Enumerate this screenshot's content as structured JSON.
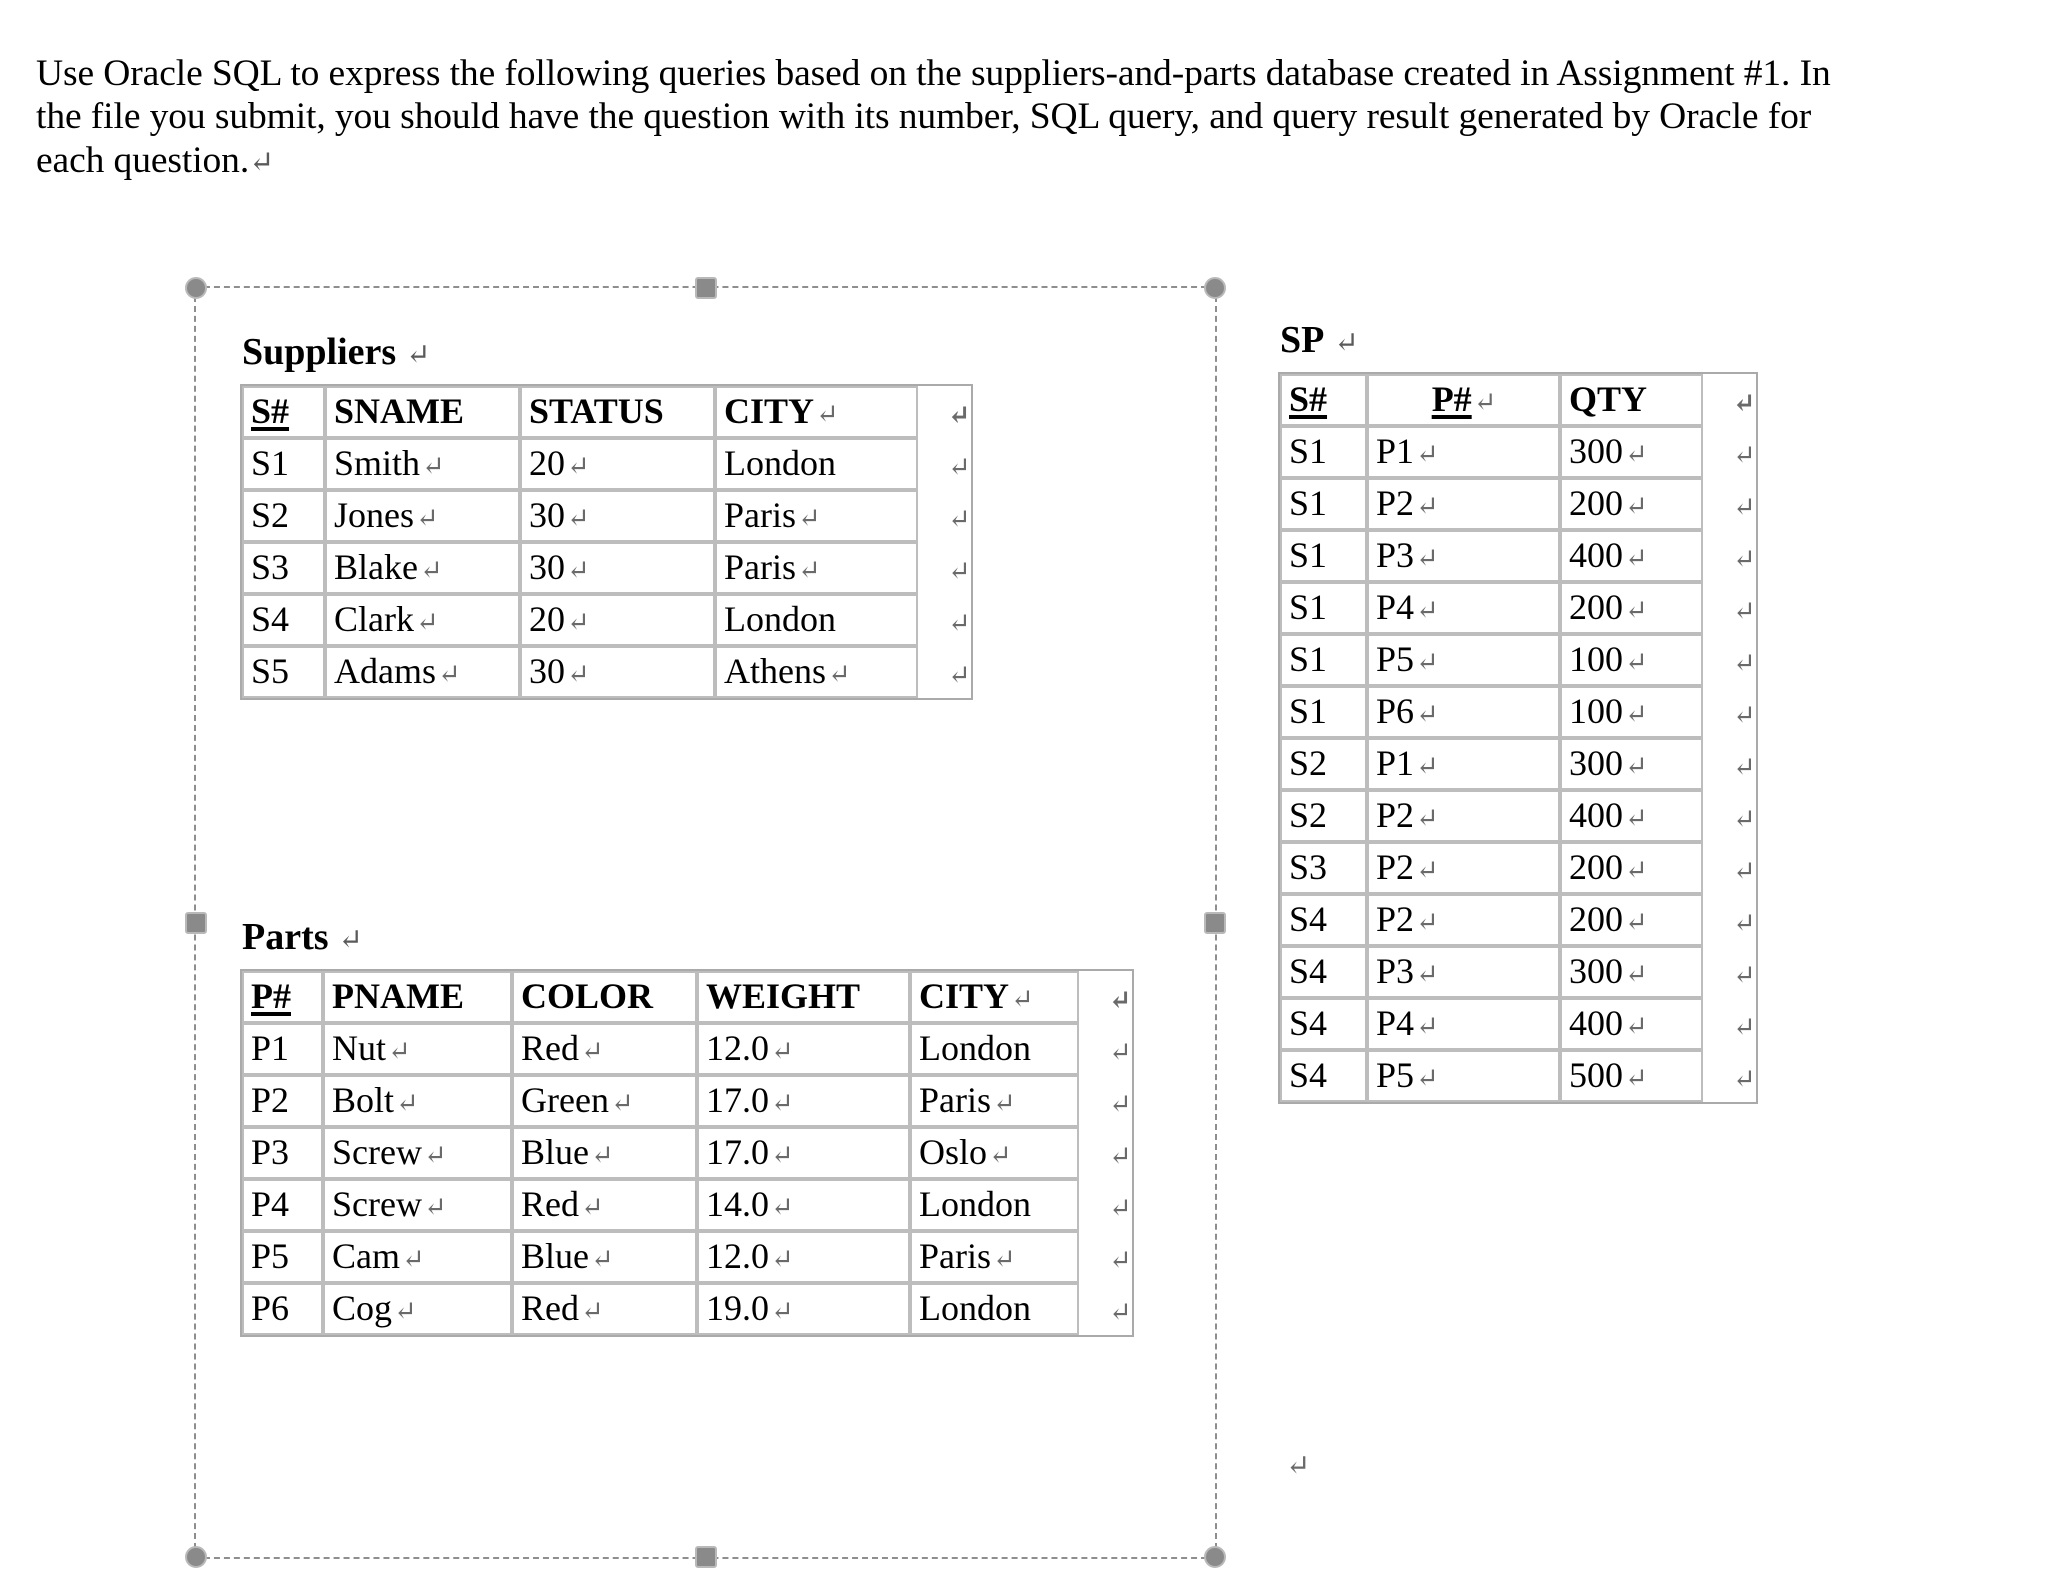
{
  "document": {
    "intro_text": "Use Oracle SQL to express the following queries based on the suppliers-and-parts database created in Assignment #1. In the file you submit, you should have the question with its number, SQL query, and query result generated by Oracle for each question.",
    "paragraph_mark": "↵",
    "trailing_mark": "↵"
  },
  "suppliers": {
    "caption": "Suppliers",
    "caption_mark": "↵",
    "headers": [
      "S#",
      "SNAME",
      "STATUS",
      "CITY"
    ],
    "header_marks": [
      "",
      "",
      "",
      "↵"
    ],
    "rows": [
      {
        "cells": [
          "S1",
          "Smith",
          "20",
          "London"
        ],
        "marks": [
          "",
          "↵",
          "↵",
          ""
        ],
        "row_mark": "↵"
      },
      {
        "cells": [
          "S2",
          "Jones",
          "30",
          "Paris"
        ],
        "marks": [
          "",
          "↵",
          "↵",
          "↵"
        ],
        "row_mark": "↵"
      },
      {
        "cells": [
          "S3",
          "Blake",
          "30",
          "Paris"
        ],
        "marks": [
          "",
          "↵",
          "↵",
          "↵"
        ],
        "row_mark": "↵"
      },
      {
        "cells": [
          "S4",
          "Clark",
          "20",
          "London"
        ],
        "marks": [
          "",
          "↵",
          "↵",
          ""
        ],
        "row_mark": "↵"
      },
      {
        "cells": [
          "S5",
          "Adams",
          "30",
          "Athens"
        ],
        "marks": [
          "",
          "↵",
          "↵",
          "↵"
        ],
        "row_mark": "↵"
      }
    ],
    "header_row_mark": "↵"
  },
  "parts": {
    "caption": "Parts",
    "caption_mark": "↵",
    "headers": [
      "P#",
      "PNAME",
      "COLOR",
      "WEIGHT",
      "CITY"
    ],
    "header_marks": [
      "",
      "",
      "",
      "",
      "↵"
    ],
    "header_row_mark": "↵",
    "rows": [
      {
        "cells": [
          "P1",
          "Nut",
          "Red",
          "12.0",
          "London"
        ],
        "marks": [
          "",
          "↵",
          "↵",
          "↵",
          ""
        ],
        "row_mark": "↵"
      },
      {
        "cells": [
          "P2",
          "Bolt",
          "Green",
          "17.0",
          "Paris"
        ],
        "marks": [
          "",
          "↵",
          "↵",
          "↵",
          "↵"
        ],
        "row_mark": "↵"
      },
      {
        "cells": [
          "P3",
          "Screw",
          "Blue",
          "17.0",
          "Oslo"
        ],
        "marks": [
          "",
          "↵",
          "↵",
          "↵",
          "↵"
        ],
        "row_mark": "↵"
      },
      {
        "cells": [
          "P4",
          "Screw",
          "Red",
          "14.0",
          "London"
        ],
        "marks": [
          "",
          "↵",
          "↵",
          "↵",
          ""
        ],
        "row_mark": "↵"
      },
      {
        "cells": [
          "P5",
          "Cam",
          "Blue",
          "12.0",
          "Paris"
        ],
        "marks": [
          "",
          "↵",
          "↵",
          "↵",
          "↵"
        ],
        "row_mark": "↵"
      },
      {
        "cells": [
          "P6",
          "Cog",
          "Red",
          "19.0",
          "London"
        ],
        "marks": [
          "",
          "↵",
          "↵",
          "↵",
          ""
        ],
        "row_mark": "↵"
      }
    ]
  },
  "sp": {
    "caption": "SP",
    "caption_mark": "↵",
    "headers": [
      "S#",
      "P#",
      "QTY"
    ],
    "header_marks": [
      "",
      "↵",
      ""
    ],
    "header_row_mark": "↵",
    "rows": [
      {
        "cells": [
          "S1",
          "P1",
          "300"
        ],
        "marks": [
          "",
          "↵",
          "↵"
        ],
        "row_mark": "↵"
      },
      {
        "cells": [
          "S1",
          "P2",
          "200"
        ],
        "marks": [
          "",
          "↵",
          "↵"
        ],
        "row_mark": "↵"
      },
      {
        "cells": [
          "S1",
          "P3",
          "400"
        ],
        "marks": [
          "",
          "↵",
          "↵"
        ],
        "row_mark": "↵"
      },
      {
        "cells": [
          "S1",
          "P4",
          "200"
        ],
        "marks": [
          "",
          "↵",
          "↵"
        ],
        "row_mark": "↵"
      },
      {
        "cells": [
          "S1",
          "P5",
          "100"
        ],
        "marks": [
          "",
          "↵",
          "↵"
        ],
        "row_mark": "↵"
      },
      {
        "cells": [
          "S1",
          "P6",
          "100"
        ],
        "marks": [
          "",
          "↵",
          "↵"
        ],
        "row_mark": "↵"
      },
      {
        "cells": [
          "S2",
          "P1",
          "300"
        ],
        "marks": [
          "",
          "↵",
          "↵"
        ],
        "row_mark": "↵"
      },
      {
        "cells": [
          "S2",
          "P2",
          "400"
        ],
        "marks": [
          "",
          "↵",
          "↵"
        ],
        "row_mark": "↵"
      },
      {
        "cells": [
          "S3",
          "P2",
          "200"
        ],
        "marks": [
          "",
          "↵",
          "↵"
        ],
        "row_mark": "↵"
      },
      {
        "cells": [
          "S4",
          "P2",
          "200"
        ],
        "marks": [
          "",
          "↵",
          "↵"
        ],
        "row_mark": "↵"
      },
      {
        "cells": [
          "S4",
          "P3",
          "300"
        ],
        "marks": [
          "",
          "↵",
          "↵"
        ],
        "row_mark": "↵"
      },
      {
        "cells": [
          "S4",
          "P4",
          "400"
        ],
        "marks": [
          "",
          "↵",
          "↵"
        ],
        "row_mark": "↵"
      },
      {
        "cells": [
          "S4",
          "P5",
          "500"
        ],
        "marks": [
          "",
          "↵",
          "↵"
        ],
        "row_mark": "↵"
      }
    ]
  },
  "selection": {
    "handle_color": "#8a8a8a",
    "border_color": "#8e8e8e"
  }
}
